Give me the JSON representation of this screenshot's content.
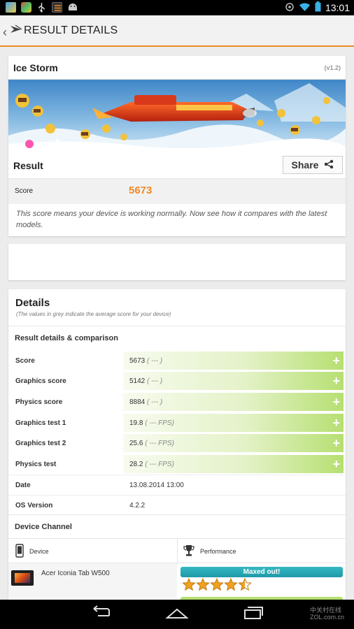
{
  "status_bar": {
    "time": "13:01",
    "icons": [
      "gallery-icon",
      "browser-icon",
      "usb-icon",
      "app-icon",
      "android-icon",
      "sync-icon",
      "wifi-icon",
      "battery-icon"
    ]
  },
  "action_bar": {
    "title": "RESULT DETAILS"
  },
  "result_card": {
    "title": "Ice Storm",
    "version": "(v1.2)",
    "result_label": "Result",
    "share_label": "Share",
    "score_label": "Score",
    "score_value": "5673",
    "note": "This score means your device is working normally. Now see how it compares with the latest models."
  },
  "details": {
    "title": "Details",
    "subtitle": "(The values in grey indicate the average score for your device)",
    "section_title": "Result details & comparison",
    "rows": [
      {
        "label": "Score",
        "value": "5673",
        "avg": "( --- )"
      },
      {
        "label": "Graphics score",
        "value": "5142",
        "avg": "( --- )"
      },
      {
        "label": "Physics score",
        "value": "8884",
        "avg": "( --- )"
      },
      {
        "label": "Graphics test 1",
        "value": "19.8",
        "avg": "( --- FPS)"
      },
      {
        "label": "Graphics test 2",
        "value": "25.6",
        "avg": "( --- FPS)"
      },
      {
        "label": "Physics test",
        "value": "28.2",
        "avg": "( --- FPS)"
      }
    ],
    "date_label": "Date",
    "date_value": "13.08.2014 13:00",
    "os_label": "OS Version",
    "os_value": "4.2.2",
    "channel_title": "Device Channel",
    "device_col": "Device",
    "performance_col": "Performance",
    "device_name": "Acer Iconia Tab W500",
    "badge": "Maxed out!",
    "rating_stars": 4.5
  },
  "watermark": {
    "line1": "中关村在线",
    "line2": "ZOL.com.cn"
  },
  "colors": {
    "accent": "#f08a24",
    "green": "#b6df71",
    "teal": "#1d99a7"
  }
}
